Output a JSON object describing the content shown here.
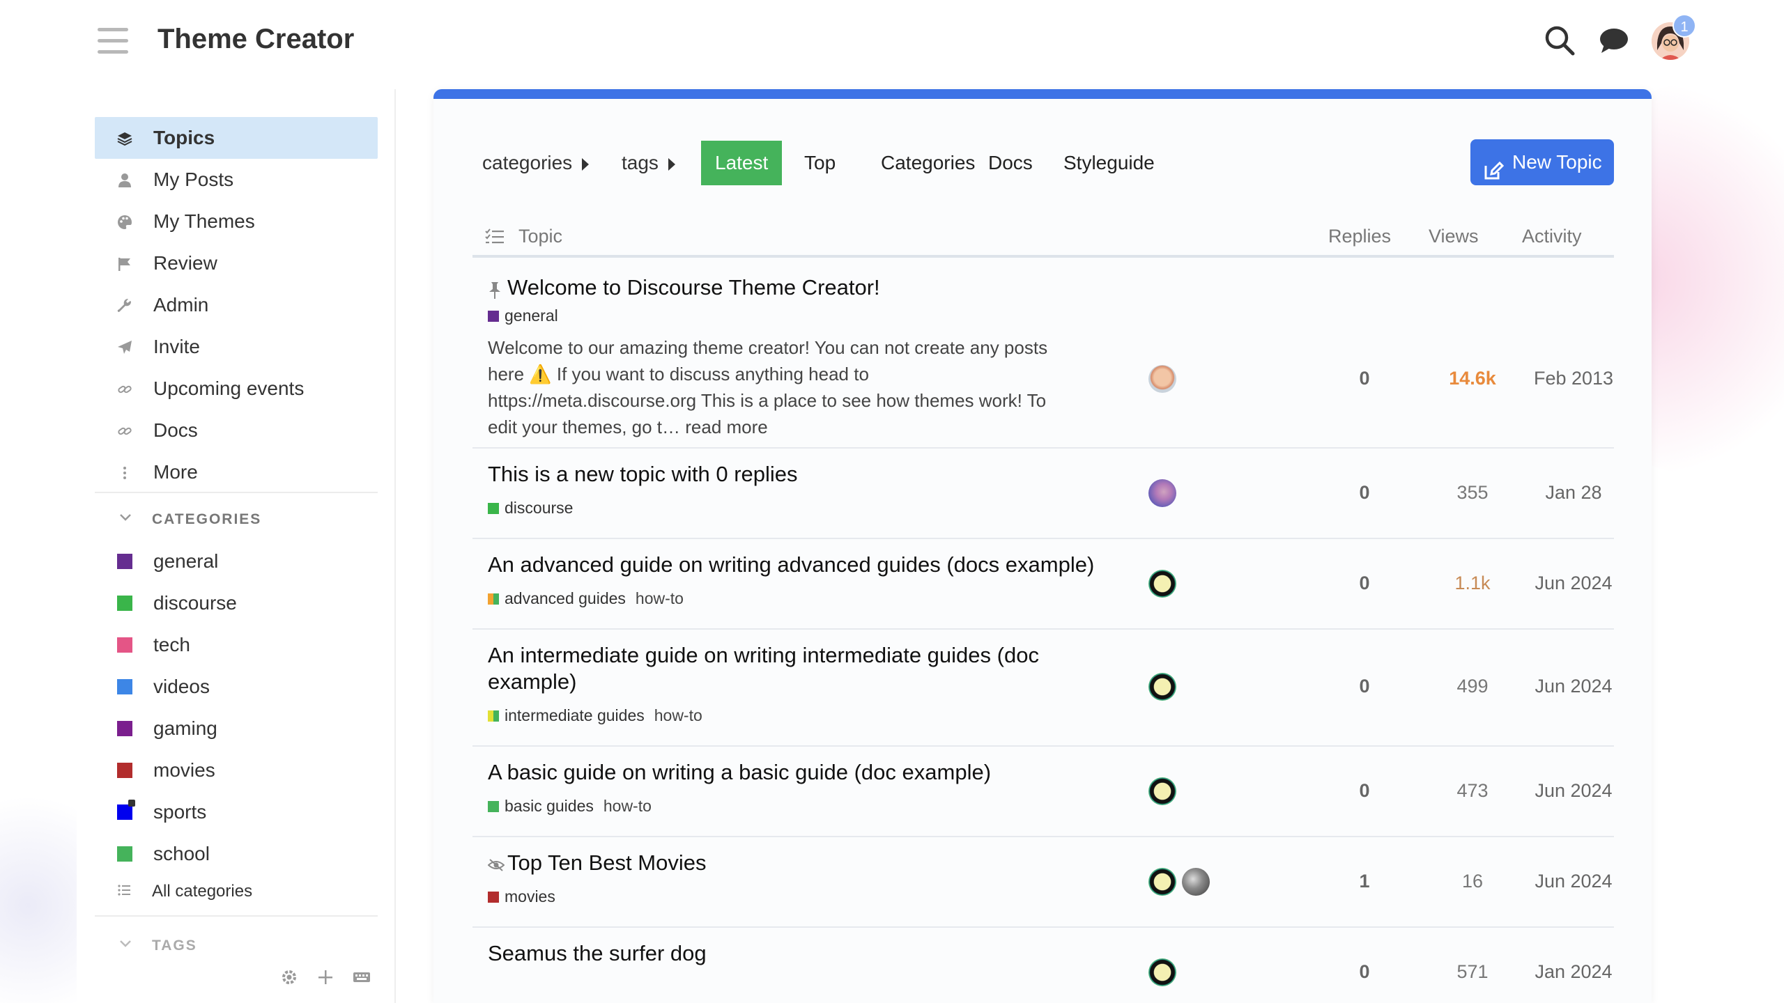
{
  "header": {
    "site_title": "Theme Creator",
    "notification_count": "1"
  },
  "sidebar": {
    "items": [
      {
        "label": "Topics",
        "icon": "layers-icon"
      },
      {
        "label": "My Posts",
        "icon": "user-icon"
      },
      {
        "label": "My Themes",
        "icon": "palette-icon"
      },
      {
        "label": "Review",
        "icon": "flag-icon"
      },
      {
        "label": "Admin",
        "icon": "wrench-icon"
      },
      {
        "label": "Invite",
        "icon": "paper-plane-icon"
      },
      {
        "label": "Upcoming events",
        "icon": "link-icon"
      },
      {
        "label": "Docs",
        "icon": "link-icon"
      },
      {
        "label": "More",
        "icon": "ellipsis-vertical-icon"
      }
    ],
    "categories_title": "CATEGORIES",
    "categories": [
      {
        "label": "general",
        "color": "#652d90"
      },
      {
        "label": "discourse",
        "color": "#3ab54a"
      },
      {
        "label": "tech",
        "color": "#e45586"
      },
      {
        "label": "videos",
        "color": "#3d86e6"
      },
      {
        "label": "gaming",
        "color": "#7b1f8e"
      },
      {
        "label": "movies",
        "color": "#b22d2d"
      },
      {
        "label": "sports",
        "color": "#0000ee"
      },
      {
        "label": "school",
        "color": "#45b35b"
      }
    ],
    "all_categories": "All categories",
    "tags_title": "TAGS"
  },
  "nav": {
    "categories_crumb": "categories",
    "tags_crumb": "tags",
    "tabs": [
      "Latest",
      "Top",
      "Categories",
      "Docs",
      "Styleguide"
    ],
    "active_tab": "Latest",
    "new_topic": "New Topic"
  },
  "table": {
    "headers": {
      "topic": "Topic",
      "replies": "Replies",
      "views": "Views",
      "activity": "Activity"
    },
    "rows": [
      {
        "title": "Welcome to Discourse Theme Creator!",
        "pinned": true,
        "category": "general",
        "category_color": "#652d90",
        "excerpt_lines": [
          "Welcome to our amazing theme creator! You can not create any posts",
          "here ⚠️ If you want to discuss anything head to",
          "https://meta.discourse.org This is a place to see how themes work! To",
          "edit your themes, go t… read more"
        ],
        "replies": "0",
        "views": "14.6k",
        "activity": "Feb 2013"
      },
      {
        "title": "This is a new topic with 0 replies",
        "category": "discourse",
        "category_color": "#3ab54a",
        "replies": "0",
        "views": "355",
        "activity": "Jan 28"
      },
      {
        "title": "An advanced guide on writing advanced guides (docs example)",
        "category": "advanced guides",
        "category_color": "#f2a230",
        "tag": "how-to",
        "replies": "0",
        "views": "1.1k",
        "activity": "Jun 2024"
      },
      {
        "title_line1": "An intermediate guide on writing intermediate guides (doc",
        "title_line2": "example)",
        "category": "intermediate guides",
        "category_color": "#e2e035",
        "tag": "how-to",
        "replies": "0",
        "views": "499",
        "activity": "Jun 2024"
      },
      {
        "title": "A basic guide on writing a basic guide (doc example)",
        "category": "basic guides",
        "category_color": "#45b35b",
        "tag": "how-to",
        "replies": "0",
        "views": "473",
        "activity": "Jun 2024"
      },
      {
        "title": "Top Ten Best Movies",
        "unlisted": true,
        "category": "movies",
        "category_color": "#b22d2d",
        "replies": "1",
        "views": "16",
        "activity": "Jun 2024"
      },
      {
        "title": "Seamus the surfer dog",
        "replies": "0",
        "views": "571",
        "activity": "Jan 2024"
      }
    ]
  },
  "colors": {
    "accent": "#3d73e6",
    "active_tab": "#45b35b",
    "sidebar_active": "#d4e7f8",
    "hot_views": "#e88a3c"
  }
}
